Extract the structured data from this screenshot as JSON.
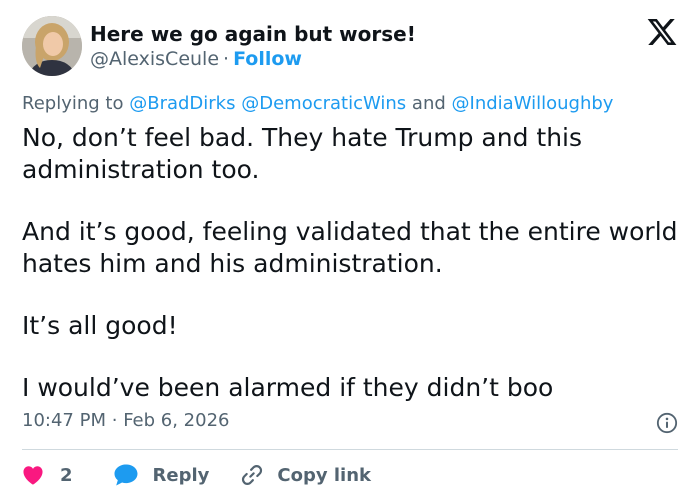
{
  "author": {
    "display_name": "Here we go again but worse!",
    "handle": "@AlexisCeule",
    "separator": "·",
    "follow_label": "Follow"
  },
  "reply_context": {
    "prefix": "Replying to",
    "mention_1": "@BradDirks",
    "mention_2": "@DemocraticWins",
    "conjunction": "and",
    "mention_3": "@IndiaWilloughby"
  },
  "tweet": {
    "paragraph_1": "No, don’t feel bad. They hate Trump and this administration too.",
    "paragraph_2": "And it’s good, feeling validated that the entire world hates him and his administration.",
    "paragraph_3": "It’s all good!",
    "paragraph_4": "I would’ve been alarmed if they didn’t boo"
  },
  "meta": {
    "time": "10:47 PM",
    "separator": "·",
    "date": "Feb 6, 2026"
  },
  "actions": {
    "like_count": "2",
    "reply_label": "Reply",
    "copy_link_label": "Copy link"
  },
  "colors": {
    "accent": "#1d9bf0",
    "like": "#f91880",
    "muted": "#536471",
    "text": "#0f1419"
  },
  "icons": {
    "brand": "x-logo-icon",
    "info": "info-icon",
    "like": "heart-icon",
    "reply": "speech-bubble-icon",
    "copy": "link-icon"
  }
}
